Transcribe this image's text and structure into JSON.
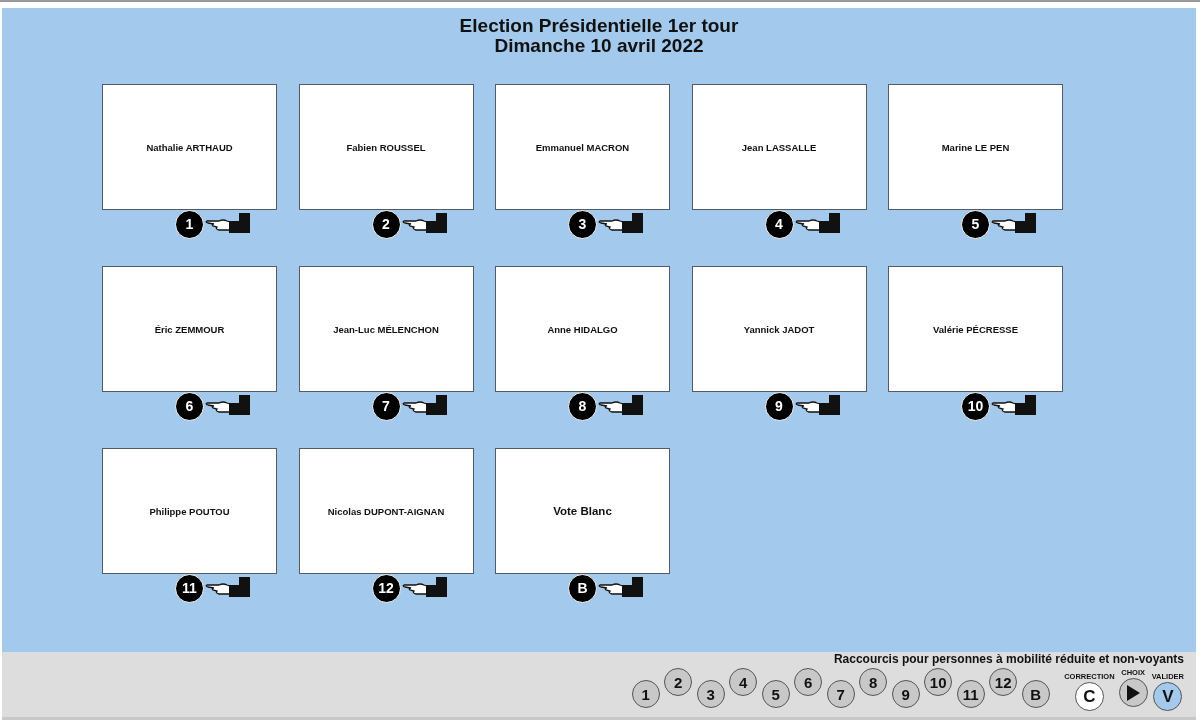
{
  "title": [
    "Election Présidentielle 1er tour",
    "Dimanche 10 avril 2022"
  ],
  "candidates": [
    {
      "name": "Nathalie ARTHAUD",
      "key": "1"
    },
    {
      "name": "Fabien ROUSSEL",
      "key": "2"
    },
    {
      "name": "Emmanuel MACRON",
      "key": "3"
    },
    {
      "name": "Jean LASSALLE",
      "key": "4"
    },
    {
      "name": "Marine LE PEN",
      "key": "5"
    },
    {
      "name": "Éric ZEMMOUR",
      "key": "6"
    },
    {
      "name": "Jean-Luc MÉLENCHON",
      "key": "7"
    },
    {
      "name": "Anne HIDALGO",
      "key": "8"
    },
    {
      "name": "Yannick JADOT",
      "key": "9"
    },
    {
      "name": "Valérie PÉCRESSE",
      "key": "10"
    },
    {
      "name": "Philippe POUTOU",
      "key": "11"
    },
    {
      "name": "Nicolas DUPONT-AIGNAN",
      "key": "12"
    },
    {
      "name": "Vote Blanc",
      "key": "B",
      "kind": "blank"
    }
  ],
  "shortcuts": {
    "caption": "Raccourcis pour personnes à mobilité réduite et non-voyants",
    "keys": [
      "1",
      "2",
      "3",
      "4",
      "5",
      "6",
      "7",
      "8",
      "9",
      "10",
      "11",
      "12",
      "B"
    ],
    "controls": [
      {
        "kind": "correction",
        "label": "CORRECTION",
        "key": "C"
      },
      {
        "kind": "choice",
        "label": "CHOIX"
      },
      {
        "kind": "validate",
        "label": "VALIDER",
        "key": "V"
      }
    ]
  }
}
